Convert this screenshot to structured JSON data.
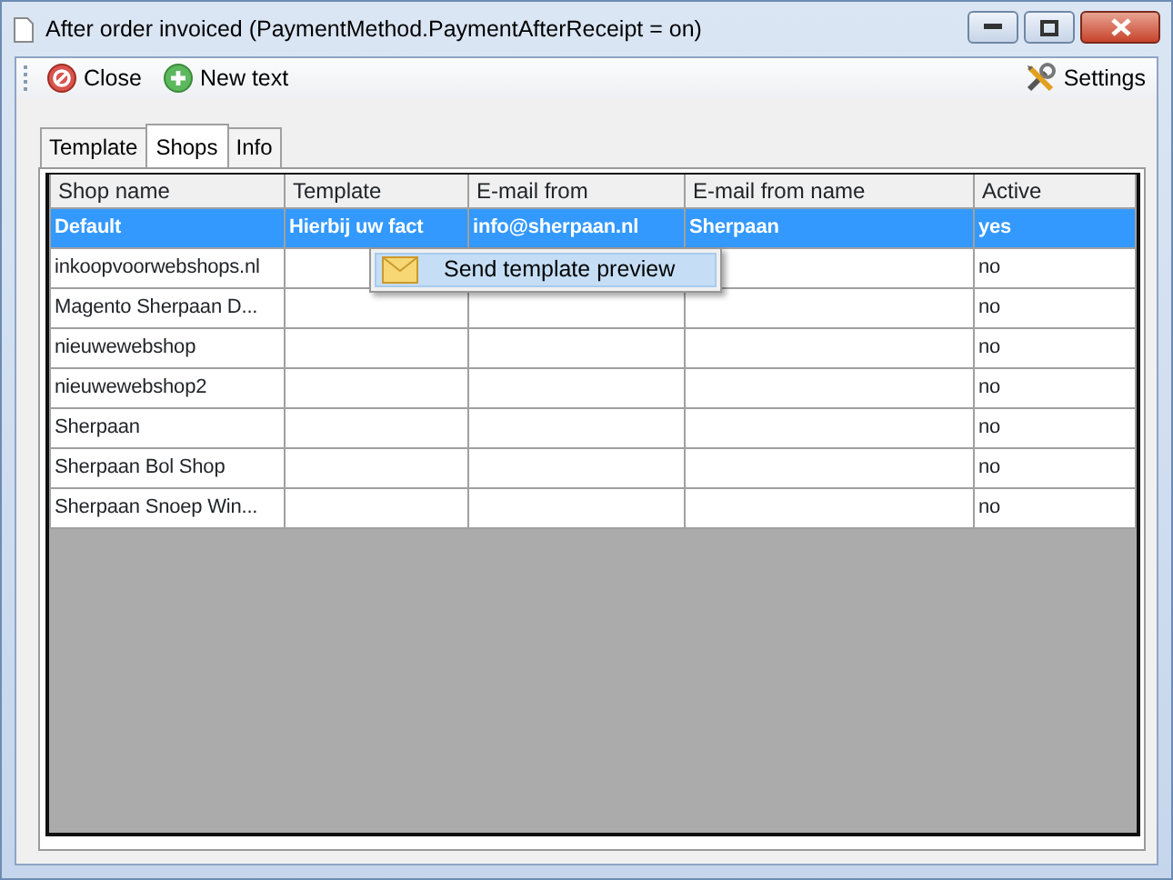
{
  "window": {
    "title": "After order invoiced (PaymentMethod.PaymentAfterReceipt = on)"
  },
  "toolbar": {
    "items": [
      {
        "label": "Close",
        "kind": "close"
      },
      {
        "label": "New text",
        "kind": "add"
      }
    ],
    "settings": {
      "label": "Settings"
    }
  },
  "tabs": [
    {
      "label": "Template",
      "selected": false
    },
    {
      "label": "Shops",
      "selected": true
    },
    {
      "label": "Info",
      "selected": false
    }
  ],
  "table": {
    "columns": [
      "Shop name",
      "Template",
      "E-mail from",
      "E-mail from name",
      "Active"
    ],
    "rows": [
      {
        "cells": [
          "Default",
          "Hierbij uw fact",
          "info@sherpaan.nl",
          "Sherpaan",
          "yes"
        ],
        "selected": true
      },
      {
        "cells": [
          "inkoopvoorwebshops.nl",
          "",
          "",
          "",
          "no"
        ],
        "selected": false
      },
      {
        "cells": [
          "Magento Sherpaan D...",
          "",
          "",
          "",
          "no"
        ],
        "selected": false
      },
      {
        "cells": [
          "nieuwewebshop",
          "",
          "",
          "",
          "no"
        ],
        "selected": false
      },
      {
        "cells": [
          "nieuwewebshop2",
          "",
          "",
          "",
          "no"
        ],
        "selected": false
      },
      {
        "cells": [
          "Sherpaan",
          "",
          "",
          "",
          "no"
        ],
        "selected": false
      },
      {
        "cells": [
          "Sherpaan Bol Shop",
          "",
          "",
          "",
          "no"
        ],
        "selected": false
      },
      {
        "cells": [
          "Sherpaan Snoep Win...",
          "",
          "",
          "",
          "no"
        ],
        "selected": false
      }
    ]
  },
  "context_menu": {
    "items": [
      {
        "label": "Send template preview"
      }
    ]
  }
}
